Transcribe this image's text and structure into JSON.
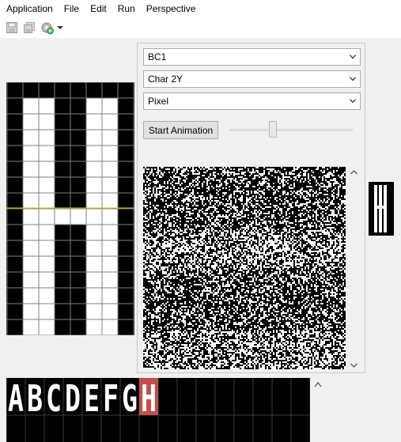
{
  "menubar": {
    "items": [
      "Application",
      "File",
      "Edit",
      "Run",
      "Perspective"
    ]
  },
  "toolbar": {
    "icons": [
      "save-icon",
      "save-all-icon",
      "run-options-icon",
      "dropdown-arrow-icon"
    ]
  },
  "panel": {
    "charset_select": "BC1",
    "char_select": "Char 2Y",
    "mode_select": "Pixel",
    "start_animation": "Start Animation",
    "slider_level": 0.34
  },
  "strip": {
    "characters": [
      "A",
      "B",
      "C",
      "D",
      "E",
      "F",
      "G",
      "H"
    ],
    "selected_index": 7,
    "selected_color": "#c0504d"
  },
  "colors": {
    "pixel_on": "#ffffff",
    "pixel_off": "#000000",
    "grid_line": "#7f7f7f",
    "cursor_line": "#e5c000",
    "app_bg": "#f0f0f0"
  }
}
